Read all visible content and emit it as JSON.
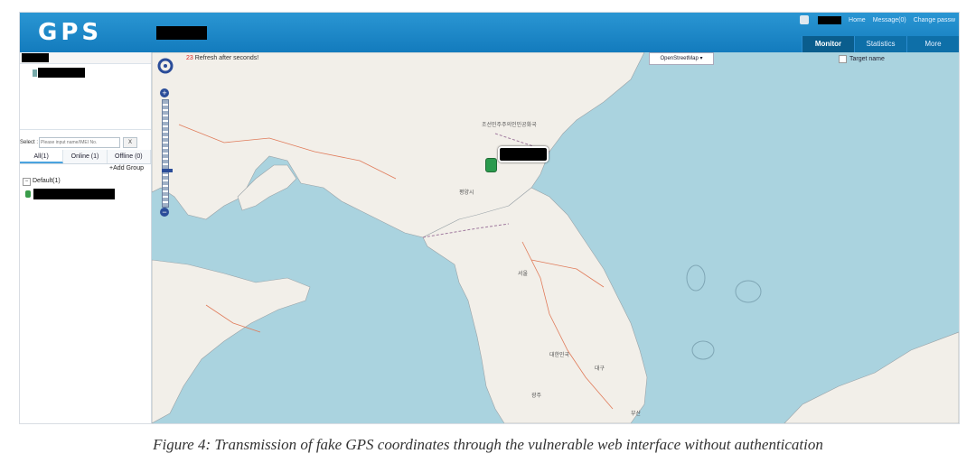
{
  "header": {
    "logo": "GPS",
    "links": [
      "Home",
      "Message(0)",
      "Change passw"
    ],
    "tabs": [
      "Monitor",
      "Statistics",
      "More"
    ]
  },
  "left_panel": {
    "select_label": "Select :",
    "search_placeholder": "Please input name/IMEI No.",
    "clear_label": "X",
    "tabs": [
      "All(1)",
      "Online (1)",
      "Offline (0)"
    ],
    "add_group": "+Add Group",
    "group_name": "Default(1)"
  },
  "map": {
    "refresh_count": "23",
    "refresh_text": "Refresh after seconds!",
    "layer": "OpenStreetMap",
    "target_label": "Target name",
    "labels": [
      "평양시",
      "서울",
      "대한민국",
      "조선민주주의인민공화국",
      "대구",
      "광주",
      "부산"
    ]
  },
  "caption": "Figure 4: Transmission of fake GPS coordinates through the vulnerable web interface without authentication"
}
